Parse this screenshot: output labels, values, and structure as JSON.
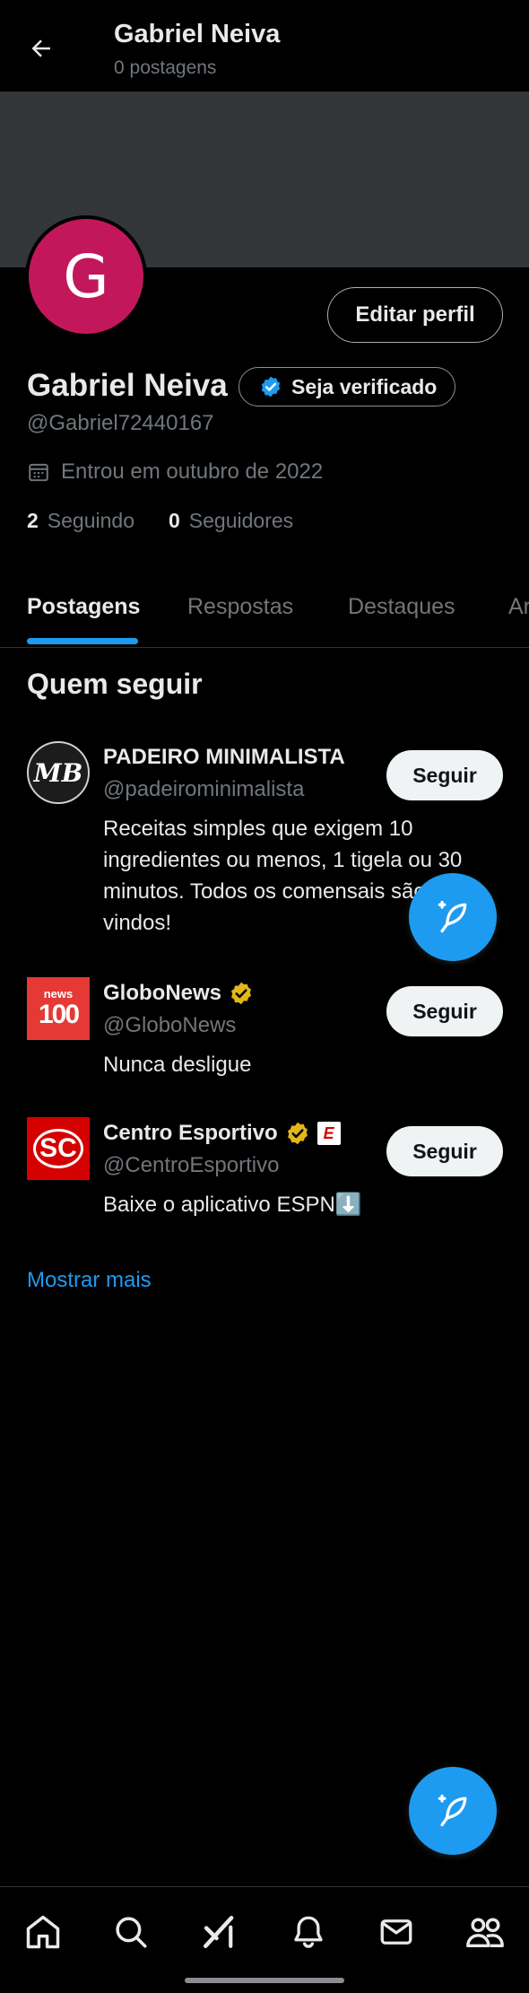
{
  "header": {
    "title": "Gabriel Neiva",
    "subtitle": "0 postagens"
  },
  "profile": {
    "avatar_letter": "G",
    "avatar_color": "#c2185b",
    "edit_label": "Editar perfil",
    "name": "Gabriel Neiva",
    "verify_label": "Seja verificado",
    "handle": "@Gabriel72440167",
    "joined": "Entrou em outubro de 2022",
    "following_count": "2",
    "following_label": "Seguindo",
    "followers_count": "0",
    "followers_label": "Seguidores"
  },
  "tabs": [
    {
      "label": "Postagens",
      "active": true
    },
    {
      "label": "Respostas"
    },
    {
      "label": "Destaques"
    },
    {
      "label": "Ar"
    }
  ],
  "who_to_follow": {
    "title": "Quem seguir",
    "show_more": "Mostrar mais",
    "items": [
      {
        "name": "PADEIRO MINIMALISTA",
        "handle": "@padeirominimalista",
        "bio": "Receitas simples que exigem 10 ingredientes ou menos, 1 tigela ou 30 minutos. Todos os comensais são bem-vindos!",
        "follow_label": "Seguir",
        "avatar_text": "MB"
      },
      {
        "name": "GloboNews",
        "handle": "@GloboNews",
        "bio": "Nunca desligue",
        "follow_label": "Seguir",
        "verified": "gold",
        "avatar_text_top": "news",
        "avatar_text_main": "100"
      },
      {
        "name": "Centro Esportivo",
        "handle": "@CentroEsportivo",
        "bio": "Baixe o aplicativo ESPN⬇️",
        "follow_label": "Seguir",
        "verified": "gold",
        "affiliate_badge": "E",
        "avatar_text": "SC"
      }
    ]
  },
  "nav": [
    "home-icon",
    "search-icon",
    "grok-icon",
    "notifications-icon",
    "messages-icon",
    "communities-icon"
  ],
  "colors": {
    "accent": "#1d9bf0",
    "background": "#000000",
    "muted": "#71767b",
    "gold": "#e2b719"
  }
}
